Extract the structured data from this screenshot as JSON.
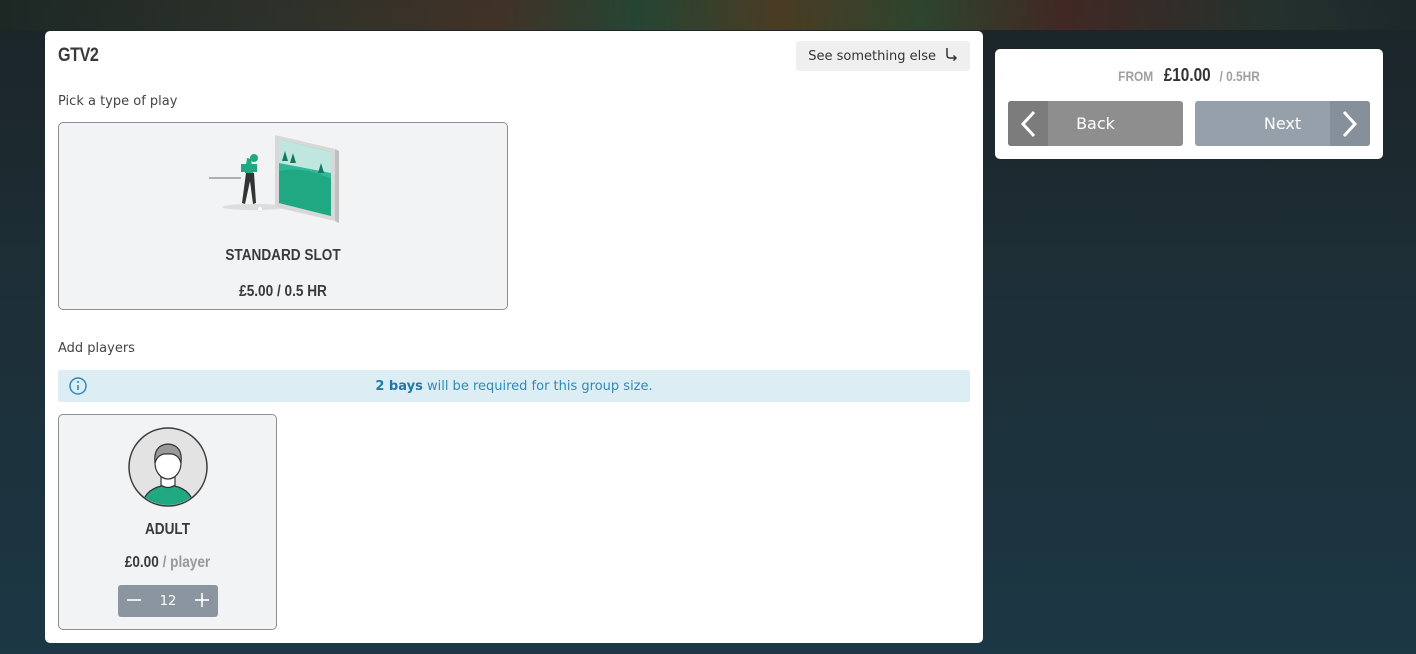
{
  "booking": {
    "title": "GTV2",
    "see_else_label": "See something else",
    "pick_label": "Pick a type of play",
    "play_option": {
      "name": "STANDARD SLOT",
      "price": "£5.00 / 0.5 HR"
    },
    "add_players_label": "Add players",
    "info": {
      "bold": "2 bays",
      "text": " will be required for this group size."
    },
    "player": {
      "name": "ADULT",
      "price": "£0.00",
      "per": "/ player",
      "quantity": "12"
    }
  },
  "summary": {
    "from_label": "FROM",
    "price": "£10.00",
    "duration": "/ 0.5HR",
    "back_label": "Back",
    "next_label": "Next"
  },
  "colors": {
    "accent_green": "#1fa882",
    "info_blue": "#2f8bb6"
  },
  "icons": [
    "return-arrow-icon",
    "info-icon",
    "minus-icon",
    "plus-icon",
    "chevron-left-icon",
    "chevron-right-icon"
  ]
}
